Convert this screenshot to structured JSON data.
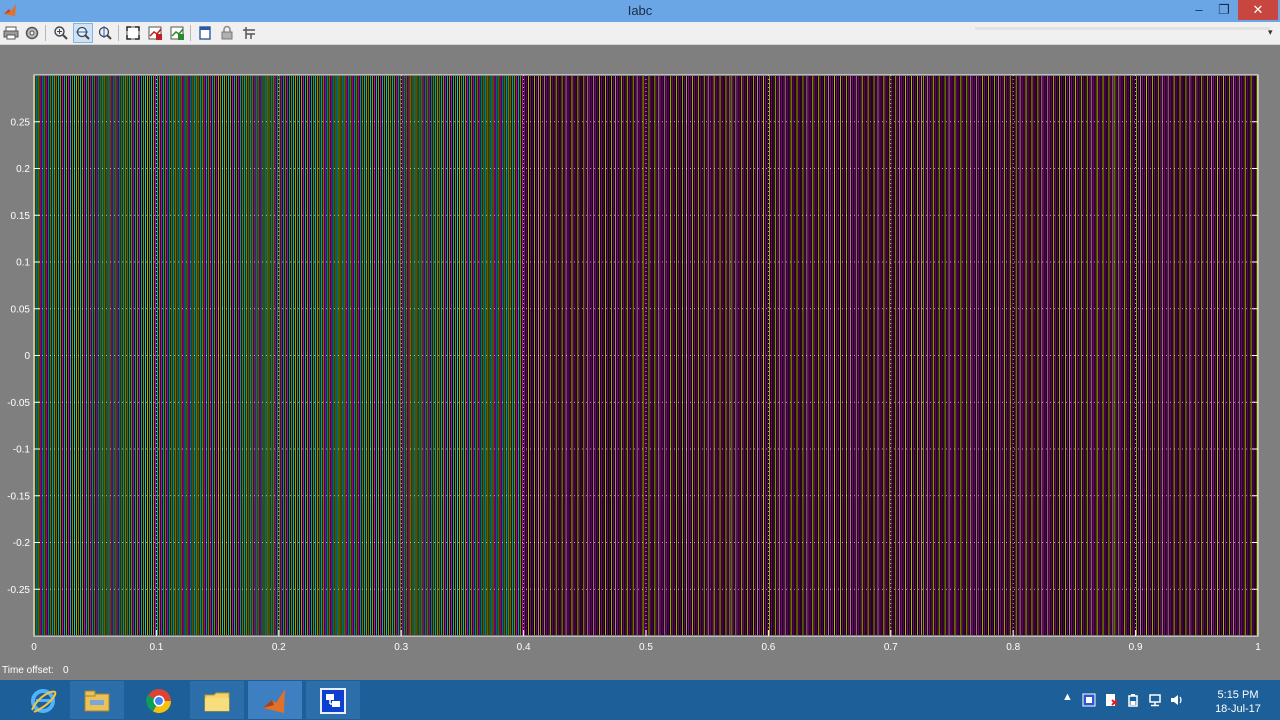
{
  "window": {
    "title": "Iabc",
    "minimize_glyph": "–",
    "maximize_glyph": "❐",
    "close_glyph": "✕"
  },
  "toolbar": {
    "buttons": [
      {
        "name": "print-icon"
      },
      {
        "name": "parameters-icon"
      },
      {
        "name": "zoom-in-icon"
      },
      {
        "name": "zoom-x-icon"
      },
      {
        "name": "zoom-y-icon"
      },
      {
        "name": "autoscale-icon"
      },
      {
        "name": "save-axes-icon"
      },
      {
        "name": "restore-axes-icon"
      },
      {
        "name": "float-icon"
      },
      {
        "name": "lock-icon"
      },
      {
        "name": "signal-selection-icon"
      }
    ]
  },
  "chart_data": {
    "type": "line",
    "title": "",
    "xlabel": "",
    "ylabel": "",
    "xlim": [
      0,
      1
    ],
    "ylim": [
      -0.3,
      0.3
    ],
    "x_ticks": [
      "0",
      "0.1",
      "0.2",
      "0.3",
      "0.4",
      "0.5",
      "0.6",
      "0.7",
      "0.8",
      "0.9",
      "1"
    ],
    "y_ticks": [
      "0.25",
      "0.2",
      "0.15",
      "0.1",
      "0.05",
      "0",
      "-0.05",
      "-0.1",
      "-0.15",
      "-0.2",
      "-0.25"
    ],
    "grid": true,
    "background": "#000000",
    "series": [
      {
        "color": "#ffff00",
        "amplitude": 0.3
      },
      {
        "color": "#ff00ff",
        "amplitude": 0.3
      },
      {
        "color": "#00ffff",
        "amplitude": 0.3
      }
    ]
  },
  "status": {
    "time_offset_label": "Time offset:",
    "time_offset_value": "0"
  },
  "taskbar": {
    "apps": [
      {
        "name": "internet-explorer-icon"
      },
      {
        "name": "file-explorer-icon"
      },
      {
        "name": "chrome-icon"
      },
      {
        "name": "folder-icon"
      },
      {
        "name": "matlab-icon"
      },
      {
        "name": "simulink-scope-icon"
      }
    ],
    "clock_time": "5:15 PM",
    "clock_date": "18-Jul-17"
  }
}
